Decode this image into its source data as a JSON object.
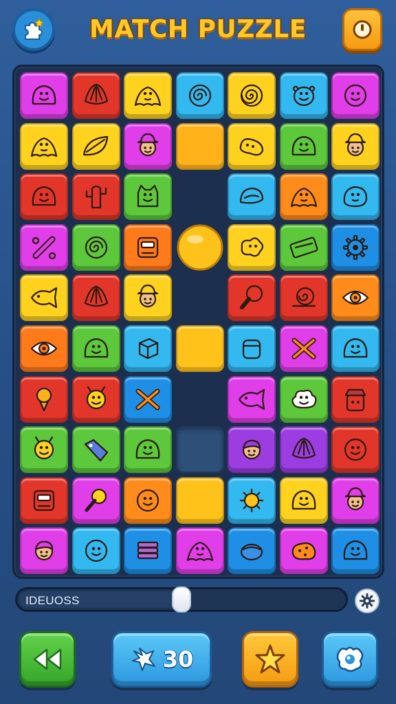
{
  "header": {
    "title": "MATCH PUZZLE",
    "logo_icon": "puzzle-piece-icon",
    "pause_icon": "pause-timer-icon"
  },
  "board": {
    "rows": 10,
    "cols": 7,
    "tiles": [
      [
        {
          "c": "#e03ee8",
          "i": "blob-face"
        },
        {
          "c": "#e2362a",
          "i": "shell"
        },
        {
          "c": "#ffd21f",
          "i": "slime"
        },
        {
          "c": "#33b8f0",
          "i": "swirl"
        },
        {
          "c": "#ffd21f",
          "i": "spiral"
        },
        {
          "c": "#33b8f0",
          "i": "alien-face"
        },
        {
          "c": "#e03ee8",
          "i": "smile-face"
        }
      ],
      [
        {
          "c": "#ffd21f",
          "i": "slime"
        },
        {
          "c": "#ffd21f",
          "i": "leaf"
        },
        {
          "c": "#e03ee8",
          "i": "person-hat"
        },
        {
          "c": "#ffb21a",
          "i": "empty"
        },
        {
          "c": "#ffd21f",
          "i": "bean"
        },
        {
          "c": "#5dc83c",
          "i": "blob-face"
        },
        {
          "c": "#ffd21f",
          "i": "person-hat"
        }
      ],
      [
        {
          "c": "#e2362a",
          "i": "blob-face"
        },
        {
          "c": "#e2362a",
          "i": "cactus"
        },
        {
          "c": "#5dc83c",
          "i": "ghost-cat"
        },
        {
          "c": "none",
          "i": "gap"
        },
        {
          "c": "#33b8f0",
          "i": "shell-round"
        },
        {
          "c": "#ff8c1a",
          "i": "slime"
        },
        {
          "c": "#33b8f0",
          "i": "rock-face"
        }
      ],
      [
        {
          "c": "#e03ee8",
          "i": "bone"
        },
        {
          "c": "#5dc83c",
          "i": "swirl"
        },
        {
          "c": "#ff7a1a",
          "i": "robot"
        },
        {
          "c": "#ffc21a",
          "i": "ball"
        },
        {
          "c": "#ffd21f",
          "i": "splat"
        },
        {
          "c": "#5dc83c",
          "i": "ticket"
        },
        {
          "c": "#1f8fe6",
          "i": "gear"
        }
      ],
      [
        {
          "c": "#ffd21f",
          "i": "fish"
        },
        {
          "c": "#e2362a",
          "i": "shell"
        },
        {
          "c": "#ffd21f",
          "i": "person-hat"
        },
        {
          "c": "none",
          "i": "gap"
        },
        {
          "c": "#e2362a",
          "i": "paddle"
        },
        {
          "c": "#e2362a",
          "i": "snail"
        },
        {
          "c": "#ff8c1a",
          "i": "eye-swirl"
        }
      ],
      [
        {
          "c": "#ff7a1a",
          "i": "eye-swirl"
        },
        {
          "c": "#5dc83c",
          "i": "blob-face"
        },
        {
          "c": "#33b8f0",
          "i": "cube"
        },
        {
          "c": "#ffc21a",
          "i": "empty"
        },
        {
          "c": "#33b8f0",
          "i": "jar"
        },
        {
          "c": "#e03ee8",
          "i": "crossed-tools"
        },
        {
          "c": "#33b8f0",
          "i": "blob-face"
        }
      ],
      [
        {
          "c": "#e2362a",
          "i": "ice-cream"
        },
        {
          "c": "#e2362a",
          "i": "bug-face"
        },
        {
          "c": "#1f8fe6",
          "i": "crossed-tools"
        },
        {
          "c": "none",
          "i": "gap"
        },
        {
          "c": "#e03ee8",
          "i": "fish"
        },
        {
          "c": "#5dc83c",
          "i": "cloud-face"
        },
        {
          "c": "#e2362a",
          "i": "robot-hat"
        }
      ],
      [
        {
          "c": "#5dc83c",
          "i": "bug-face"
        },
        {
          "c": "#5dc83c",
          "i": "tag"
        },
        {
          "c": "#5dc83c",
          "i": "blob-face"
        },
        {
          "c": "none",
          "i": "hole"
        },
        {
          "c": "#9b3de0",
          "i": "person"
        },
        {
          "c": "#9b3de0",
          "i": "shell"
        },
        {
          "c": "#e2362a",
          "i": "smile-face"
        }
      ],
      [
        {
          "c": "#e2362a",
          "i": "robot"
        },
        {
          "c": "#e03ee8",
          "i": "lollipop"
        },
        {
          "c": "#ff8c1a",
          "i": "smile-face"
        },
        {
          "c": "#ffc21a",
          "i": "empty"
        },
        {
          "c": "#33b8f0",
          "i": "sun"
        },
        {
          "c": "#ffd21f",
          "i": "blob-face"
        },
        {
          "c": "#e03ee8",
          "i": "person-hat"
        }
      ],
      [
        {
          "c": "#e03ee8",
          "i": "person"
        },
        {
          "c": "#33b8f0",
          "i": "smile-face"
        },
        {
          "c": "#1f8fe6",
          "i": "stack"
        },
        {
          "c": "#e03ee8",
          "i": "slime"
        },
        {
          "c": "#1f8fe6",
          "i": "pot"
        },
        {
          "c": "#e03ee8",
          "i": "cookie"
        },
        {
          "c": "#1f8fe6",
          "i": "blob-face"
        }
      ]
    ]
  },
  "progress": {
    "label": "IDEUOSS",
    "value": 0.5
  },
  "bottom_bar": {
    "back_icon": "rewind-icon",
    "moves_icon": "star-burst-icon",
    "moves_count": "30",
    "star_icon": "star-icon",
    "shop_icon": "gem-icon"
  }
}
